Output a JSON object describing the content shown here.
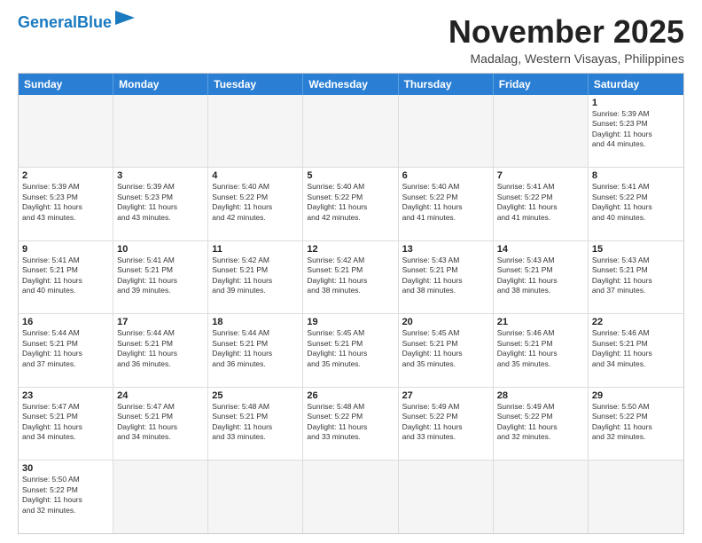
{
  "header": {
    "logo_general": "General",
    "logo_blue": "Blue",
    "month_title": "November 2025",
    "location": "Madalag, Western Visayas, Philippines"
  },
  "weekdays": [
    "Sunday",
    "Monday",
    "Tuesday",
    "Wednesday",
    "Thursday",
    "Friday",
    "Saturday"
  ],
  "rows": [
    [
      {
        "day": "",
        "text": ""
      },
      {
        "day": "",
        "text": ""
      },
      {
        "day": "",
        "text": ""
      },
      {
        "day": "",
        "text": ""
      },
      {
        "day": "",
        "text": ""
      },
      {
        "day": "",
        "text": ""
      },
      {
        "day": "1",
        "text": "Sunrise: 5:39 AM\nSunset: 5:23 PM\nDaylight: 11 hours\nand 44 minutes."
      }
    ],
    [
      {
        "day": "2",
        "text": "Sunrise: 5:39 AM\nSunset: 5:23 PM\nDaylight: 11 hours\nand 43 minutes."
      },
      {
        "day": "3",
        "text": "Sunrise: 5:39 AM\nSunset: 5:23 PM\nDaylight: 11 hours\nand 43 minutes."
      },
      {
        "day": "4",
        "text": "Sunrise: 5:40 AM\nSunset: 5:22 PM\nDaylight: 11 hours\nand 42 minutes."
      },
      {
        "day": "5",
        "text": "Sunrise: 5:40 AM\nSunset: 5:22 PM\nDaylight: 11 hours\nand 42 minutes."
      },
      {
        "day": "6",
        "text": "Sunrise: 5:40 AM\nSunset: 5:22 PM\nDaylight: 11 hours\nand 41 minutes."
      },
      {
        "day": "7",
        "text": "Sunrise: 5:41 AM\nSunset: 5:22 PM\nDaylight: 11 hours\nand 41 minutes."
      },
      {
        "day": "8",
        "text": "Sunrise: 5:41 AM\nSunset: 5:22 PM\nDaylight: 11 hours\nand 40 minutes."
      }
    ],
    [
      {
        "day": "9",
        "text": "Sunrise: 5:41 AM\nSunset: 5:21 PM\nDaylight: 11 hours\nand 40 minutes."
      },
      {
        "day": "10",
        "text": "Sunrise: 5:41 AM\nSunset: 5:21 PM\nDaylight: 11 hours\nand 39 minutes."
      },
      {
        "day": "11",
        "text": "Sunrise: 5:42 AM\nSunset: 5:21 PM\nDaylight: 11 hours\nand 39 minutes."
      },
      {
        "day": "12",
        "text": "Sunrise: 5:42 AM\nSunset: 5:21 PM\nDaylight: 11 hours\nand 38 minutes."
      },
      {
        "day": "13",
        "text": "Sunrise: 5:43 AM\nSunset: 5:21 PM\nDaylight: 11 hours\nand 38 minutes."
      },
      {
        "day": "14",
        "text": "Sunrise: 5:43 AM\nSunset: 5:21 PM\nDaylight: 11 hours\nand 38 minutes."
      },
      {
        "day": "15",
        "text": "Sunrise: 5:43 AM\nSunset: 5:21 PM\nDaylight: 11 hours\nand 37 minutes."
      }
    ],
    [
      {
        "day": "16",
        "text": "Sunrise: 5:44 AM\nSunset: 5:21 PM\nDaylight: 11 hours\nand 37 minutes."
      },
      {
        "day": "17",
        "text": "Sunrise: 5:44 AM\nSunset: 5:21 PM\nDaylight: 11 hours\nand 36 minutes."
      },
      {
        "day": "18",
        "text": "Sunrise: 5:44 AM\nSunset: 5:21 PM\nDaylight: 11 hours\nand 36 minutes."
      },
      {
        "day": "19",
        "text": "Sunrise: 5:45 AM\nSunset: 5:21 PM\nDaylight: 11 hours\nand 35 minutes."
      },
      {
        "day": "20",
        "text": "Sunrise: 5:45 AM\nSunset: 5:21 PM\nDaylight: 11 hours\nand 35 minutes."
      },
      {
        "day": "21",
        "text": "Sunrise: 5:46 AM\nSunset: 5:21 PM\nDaylight: 11 hours\nand 35 minutes."
      },
      {
        "day": "22",
        "text": "Sunrise: 5:46 AM\nSunset: 5:21 PM\nDaylight: 11 hours\nand 34 minutes."
      }
    ],
    [
      {
        "day": "23",
        "text": "Sunrise: 5:47 AM\nSunset: 5:21 PM\nDaylight: 11 hours\nand 34 minutes."
      },
      {
        "day": "24",
        "text": "Sunrise: 5:47 AM\nSunset: 5:21 PM\nDaylight: 11 hours\nand 34 minutes."
      },
      {
        "day": "25",
        "text": "Sunrise: 5:48 AM\nSunset: 5:21 PM\nDaylight: 11 hours\nand 33 minutes."
      },
      {
        "day": "26",
        "text": "Sunrise: 5:48 AM\nSunset: 5:22 PM\nDaylight: 11 hours\nand 33 minutes."
      },
      {
        "day": "27",
        "text": "Sunrise: 5:49 AM\nSunset: 5:22 PM\nDaylight: 11 hours\nand 33 minutes."
      },
      {
        "day": "28",
        "text": "Sunrise: 5:49 AM\nSunset: 5:22 PM\nDaylight: 11 hours\nand 32 minutes."
      },
      {
        "day": "29",
        "text": "Sunrise: 5:50 AM\nSunset: 5:22 PM\nDaylight: 11 hours\nand 32 minutes."
      }
    ],
    [
      {
        "day": "30",
        "text": "Sunrise: 5:50 AM\nSunset: 5:22 PM\nDaylight: 11 hours\nand 32 minutes."
      },
      {
        "day": "",
        "text": ""
      },
      {
        "day": "",
        "text": ""
      },
      {
        "day": "",
        "text": ""
      },
      {
        "day": "",
        "text": ""
      },
      {
        "day": "",
        "text": ""
      },
      {
        "day": "",
        "text": ""
      }
    ]
  ]
}
